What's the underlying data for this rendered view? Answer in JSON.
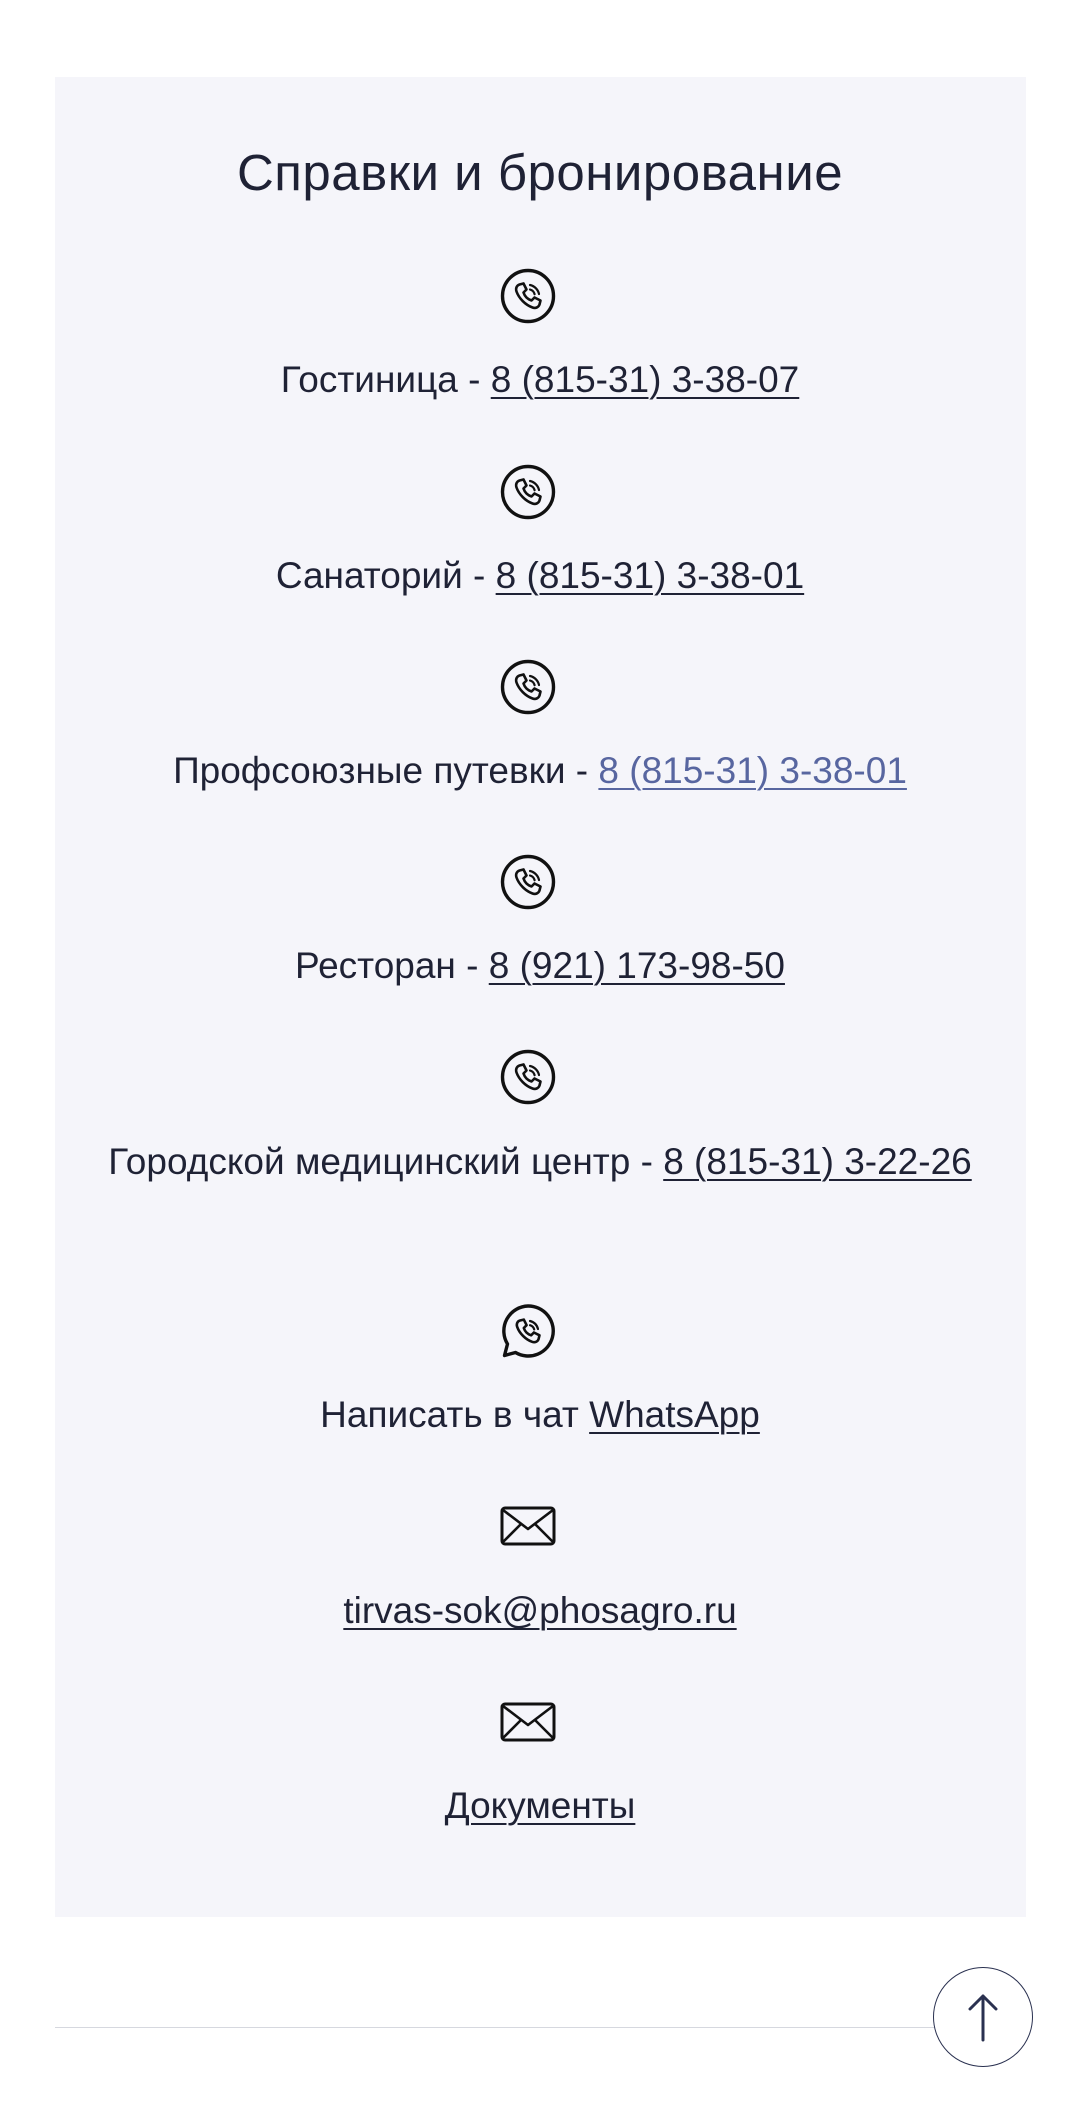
{
  "title": "Справки и бронирование",
  "contacts": [
    {
      "icon": "phone-icon",
      "label": "Гостиница - ",
      "link": "8 (815-31) 3-38-07"
    },
    {
      "icon": "phone-icon",
      "label": "Санаторий - ",
      "link": "8 (815-31) 3-38-01"
    },
    {
      "icon": "phone-icon",
      "label": "Профсоюзные путевки - ",
      "link": "8 (815-31) 3-38-01"
    },
    {
      "icon": "phone-icon",
      "label": "Ресторан - ",
      "link": "8 (921) 173-98-50"
    },
    {
      "icon": "phone-icon",
      "label": "Городской медицинский центр - ",
      "link": "8 (815-31) 3-22-26"
    },
    {
      "icon": "whatsapp-icon",
      "label": "Написать в чат ",
      "link": "WhatsApp"
    },
    {
      "icon": "envelope-icon",
      "label": "",
      "link": "tirvas-sok@phosagro.ru"
    },
    {
      "icon": "envelope-icon",
      "label": "",
      "link": "Документы"
    }
  ],
  "scroll_top_button": {
    "icon": "arrow-up-icon"
  },
  "colors": {
    "card_background": "#f5f5fa",
    "text": "#1f2235",
    "accent_link": "#5866a0"
  }
}
